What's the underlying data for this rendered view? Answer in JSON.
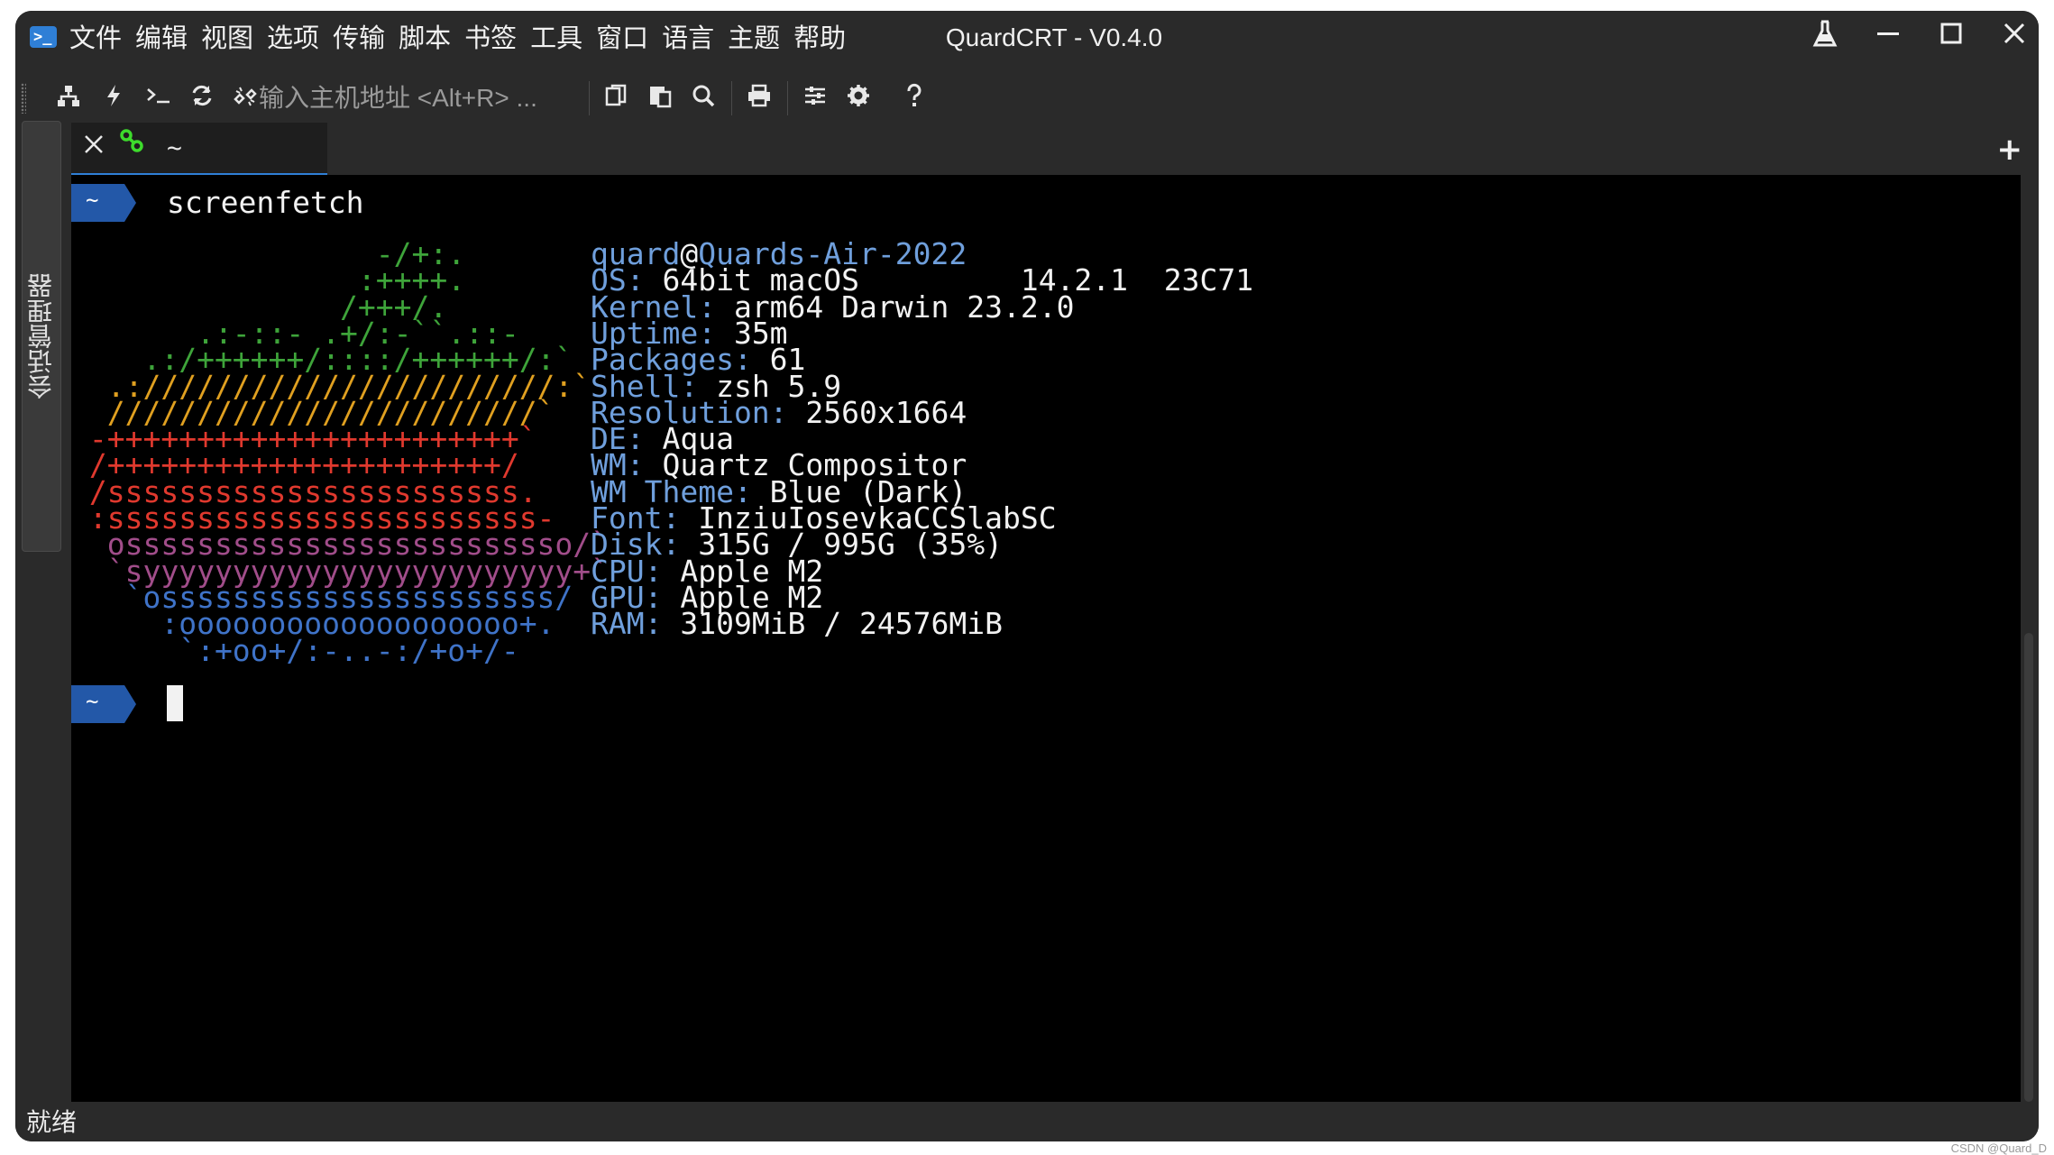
{
  "window": {
    "title": "QuardCRT - V0.4.0",
    "app_icon": ">_"
  },
  "menu": [
    "文件",
    "编辑",
    "视图",
    "选项",
    "传输",
    "脚本",
    "书签",
    "工具",
    "窗口",
    "语言",
    "主题",
    "帮助"
  ],
  "toolbar": {
    "host_placeholder": "输入主机地址 <Alt+R> ...",
    "icons": [
      "connect-icon",
      "quick-connect-icon",
      "terminal-icon",
      "reconnect-icon",
      "disconnect-icon",
      "copy-icon",
      "paste-icon",
      "find-icon",
      "print-icon",
      "session-options-icon",
      "settings-icon",
      "help-icon"
    ]
  },
  "side_panel": {
    "label": "会话管理器"
  },
  "tabs": [
    {
      "label": "~"
    }
  ],
  "terminal": {
    "prompt_label": "~",
    "command": "screenfetch",
    "ascii_art": [
      {
        "text": "                 -/+:.",
        "color": "#3ea43a"
      },
      {
        "text": "                :++++.",
        "color": "#3ea43a"
      },
      {
        "text": "               /+++/.",
        "color": "#3ea43a"
      },
      {
        "text": "       .:-::- .+/:-``.::-",
        "color": "#3ea43a"
      },
      {
        "text": "    .:/++++++/::::/++++++/:`",
        "color": "#3ea43a"
      },
      {
        "text": "  .:///////////////////////:`",
        "color": "#e0a020"
      },
      {
        "text": "  ////////////////////////`",
        "color": "#e0a020"
      },
      {
        "text": " -+++++++++++++++++++++++`",
        "color": "#e0392e"
      },
      {
        "text": " /++++++++++++++++++++++/",
        "color": "#e0392e"
      },
      {
        "text": " /sssssssssssssssssssssss.",
        "color": "#e0392e"
      },
      {
        "text": " :ssssssssssssssssssssssss-",
        "color": "#e0392e"
      },
      {
        "text": "  osssssssssssssssssssssssso/`",
        "color": "#a14d8a"
      },
      {
        "text": "  `syyyyyyyyyyyyyyyyyyyyyyyy+`",
        "color": "#a14d8a"
      },
      {
        "text": "   `ossssssssssssssssssssss/",
        "color": "#3f73c8"
      },
      {
        "text": "     :ooooooooooooooooooo+.",
        "color": "#3f73c8"
      },
      {
        "text": "      `:+oo+/:-..-:/+o+/-",
        "color": "#3f73c8"
      }
    ],
    "user": "quard",
    "at": "@",
    "host": "Quards-Air-2022",
    "info": [
      {
        "key": "OS:",
        "value": " 64bit macOS         14.2.1  23C71"
      },
      {
        "key": "Kernel:",
        "value": " arm64 Darwin 23.2.0"
      },
      {
        "key": "Uptime:",
        "value": " 35m"
      },
      {
        "key": "Packages:",
        "value": " 61"
      },
      {
        "key": "Shell:",
        "value": " zsh 5.9"
      },
      {
        "key": "Resolution:",
        "value": " 2560x1664"
      },
      {
        "key": "DE:",
        "value": " Aqua"
      },
      {
        "key": "WM:",
        "value": " Quartz Compositor"
      },
      {
        "key": "WM Theme:",
        "value": " Blue (Dark)"
      },
      {
        "key": "Font:",
        "value": " InziuIosevkaCCSlabSC"
      },
      {
        "key": "Disk:",
        "value": " 315G / 995G (35%)"
      },
      {
        "key": "CPU:",
        "value": " Apple M2"
      },
      {
        "key": "GPU:",
        "value": " Apple M2"
      },
      {
        "key": "RAM:",
        "value": " 3109MiB / 24576MiB"
      }
    ]
  },
  "status": {
    "text": "就绪"
  },
  "watermark": "CSDN @Quard_D",
  "colors": {
    "accent": "#2f7fd6",
    "prompt_bg": "#2358a8",
    "info_key": "#6f9fdc"
  }
}
